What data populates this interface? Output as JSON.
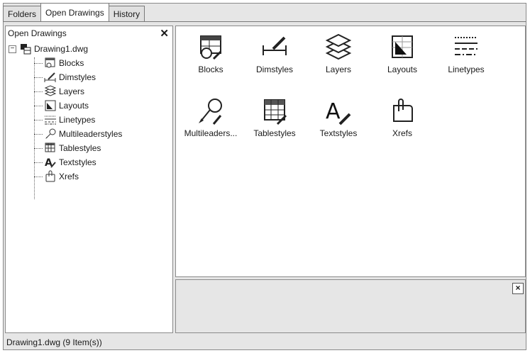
{
  "tabs": [
    "Folders",
    "Open Drawings",
    "History"
  ],
  "left_pane": {
    "title": "Open Drawings",
    "close": "✕",
    "root": {
      "label": "Drawing1.dwg",
      "expander": "−"
    },
    "children": [
      "Blocks",
      "Dimstyles",
      "Layers",
      "Layouts",
      "Linetypes",
      "Multileaderstyles",
      "Tablestyles",
      "Textstyles",
      "Xrefs"
    ]
  },
  "content": {
    "items": [
      "Blocks",
      "Dimstyles",
      "Layers",
      "Layouts",
      "Linetypes",
      "Multileaders...",
      "Tablestyles",
      "Textstyles",
      "Xrefs"
    ],
    "icons": [
      "blocks-icon",
      "dimstyles-icon",
      "layers-icon",
      "layouts-icon",
      "linetypes-icon",
      "multileaders-icon",
      "tablestyles-icon",
      "textstyles-icon",
      "xrefs-icon"
    ]
  },
  "preview": {
    "close": "×"
  },
  "status_bar": {
    "text": "Drawing1.dwg (9 Item(s))"
  }
}
